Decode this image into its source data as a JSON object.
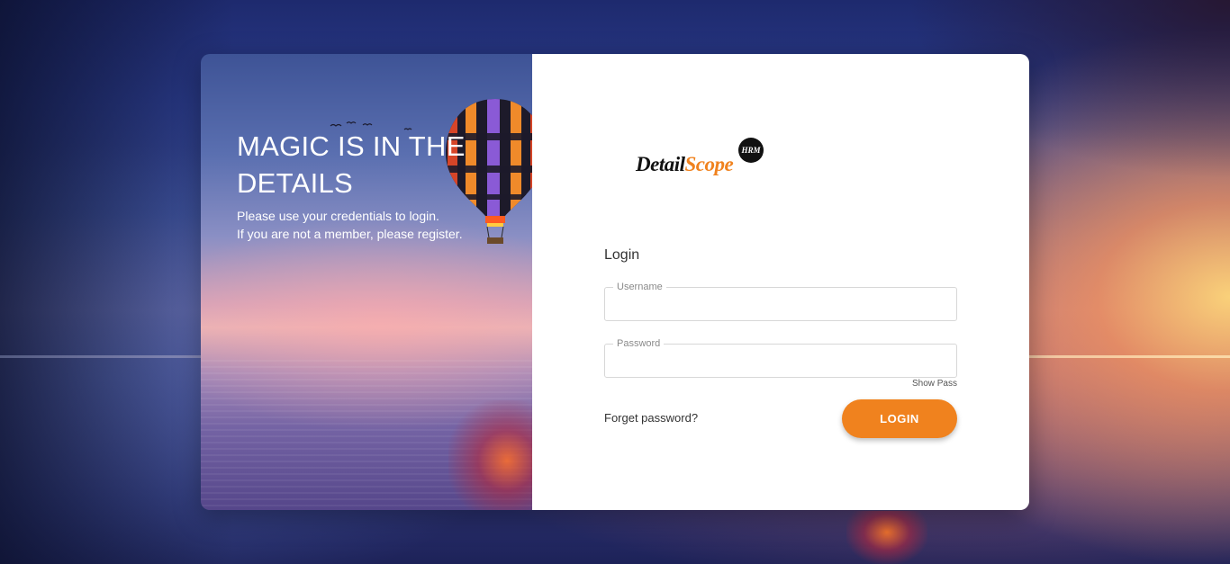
{
  "hero": {
    "title": "MAGIC IS IN THE DETAILS",
    "line1": "Please use your credentials to login.",
    "line2": "If you are not a member, please register."
  },
  "logo": {
    "word1": "Detail",
    "word2": "Scope",
    "badge": "HRM"
  },
  "login": {
    "heading": "Login",
    "username_label": "Username",
    "username_value": "",
    "password_label": "Password",
    "password_value": "",
    "show_pass": "Show Pass",
    "forget_password": "Forget password?",
    "submit": "LOGIN"
  },
  "colors": {
    "accent": "#f0821e",
    "text": "#333333",
    "panel": "#ffffff"
  },
  "icons": {
    "balloon": "hot-air-balloon-icon",
    "birds": "birds-icon"
  }
}
